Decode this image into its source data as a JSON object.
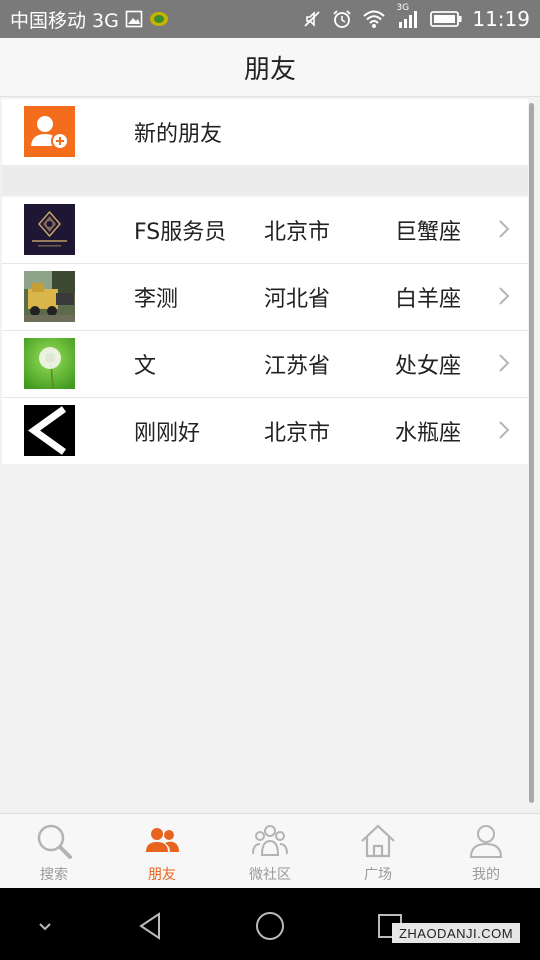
{
  "status_bar": {
    "carrier": "中国移动 3G",
    "time": "11:19",
    "network_badge": "3G",
    "icons": [
      "image-icon",
      "app-notification-icon",
      "mute-icon",
      "alarm-icon",
      "wifi-icon",
      "signal-icon",
      "battery-icon"
    ]
  },
  "header": {
    "title": "朋友"
  },
  "new_friends": {
    "label": "新的朋友",
    "icon": "add-contact-icon",
    "icon_color": "#f36d1c"
  },
  "friends": [
    {
      "name": "FS服务员",
      "city": "北京市",
      "sign": "巨蟹座",
      "avatar": "fashion-singles-logo",
      "avatar_text": "FASHION SINGLES"
    },
    {
      "name": "李测",
      "city": "河北省",
      "sign": "白羊座",
      "avatar": "truck-photo"
    },
    {
      "name": "文",
      "city": "江苏省",
      "sign": "处女座",
      "avatar": "dandelion-photo"
    },
    {
      "name": "刚刚好",
      "city": "北京市",
      "sign": "水瓶座",
      "avatar": "arrow-left-image"
    }
  ],
  "tabs": [
    {
      "label": "搜索",
      "icon": "search-icon",
      "active": false
    },
    {
      "label": "朋友",
      "icon": "friends-icon",
      "active": true
    },
    {
      "label": "微社区",
      "icon": "community-icon",
      "active": false
    },
    {
      "label": "广场",
      "icon": "home-icon",
      "active": false
    },
    {
      "label": "我的",
      "icon": "profile-icon",
      "active": false
    }
  ],
  "nav_bar": {
    "icons": [
      "collapse-icon",
      "back-icon",
      "home-circle-icon",
      "recents-icon"
    ]
  },
  "watermark": "ZHAODANJI.COM",
  "colors": {
    "accent": "#e8641e",
    "inactive": "#9a9a9a",
    "status_bar": "#7a7a7a"
  }
}
